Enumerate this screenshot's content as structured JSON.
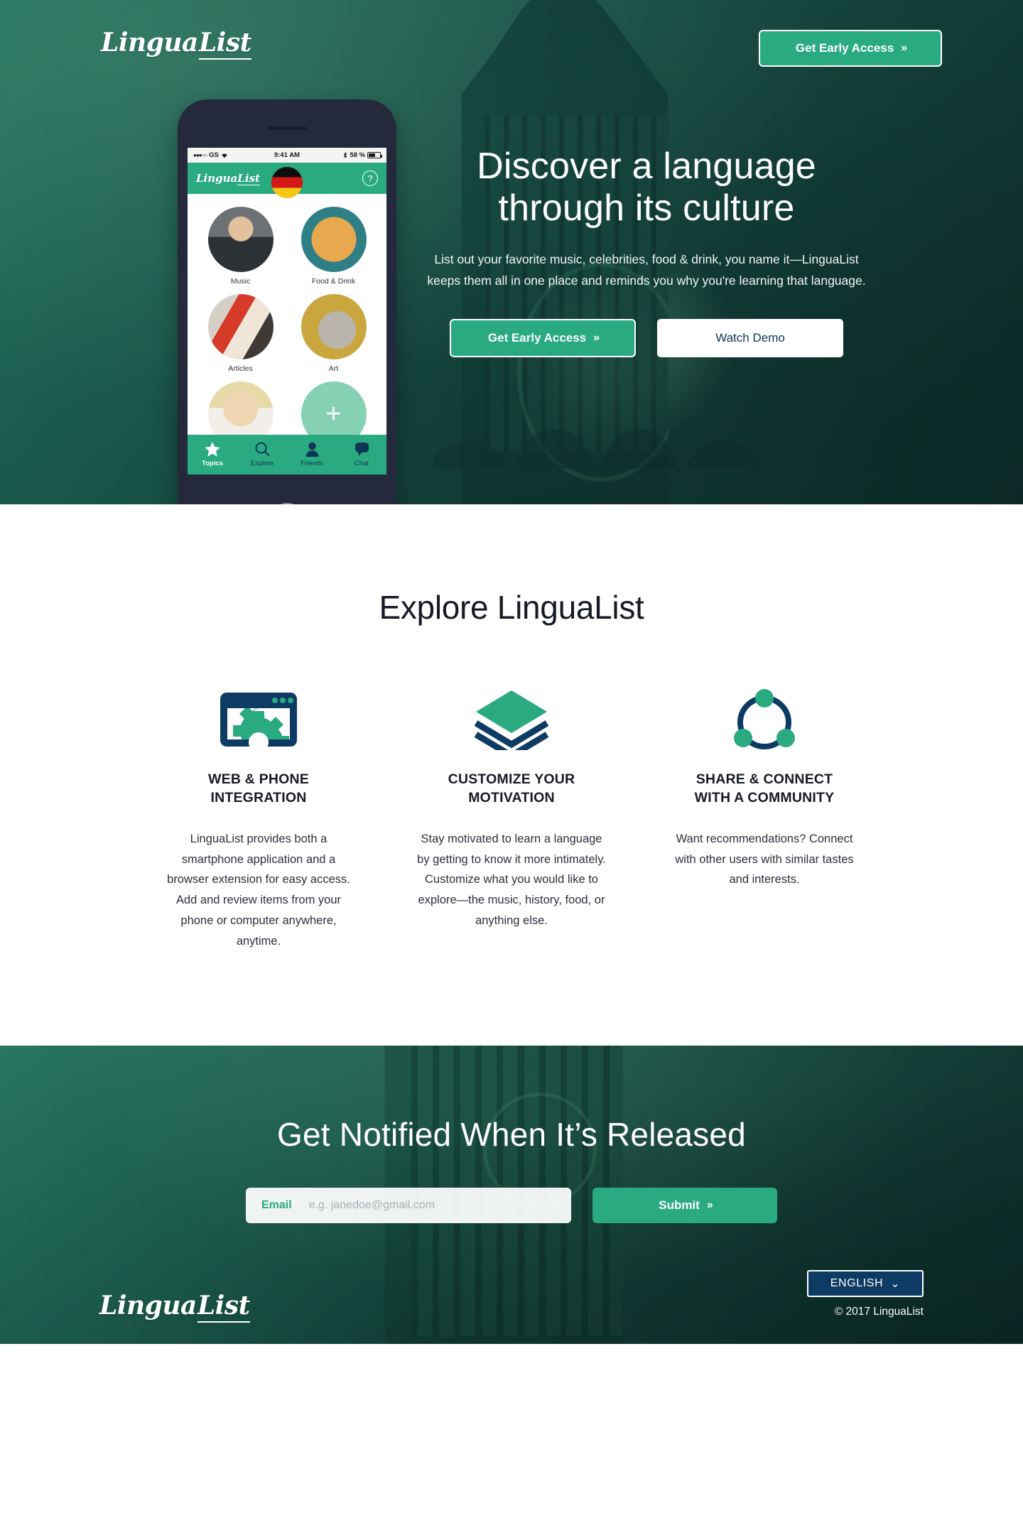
{
  "brand": {
    "name_part1": "Lingua",
    "name_part2": "List",
    "accent_green": "#2aaa80",
    "navy": "#0f3557"
  },
  "header": {
    "logo_part1": "Lingua",
    "logo_part2": "List",
    "cta_label": "Get Early Access",
    "cta_chevron": "»"
  },
  "hero": {
    "title_line1": "Discover a language",
    "title_line2": "through its culture",
    "subtitle": "List out your favorite music, celebrities, food & drink, you name it—LinguaList keeps them all in one place and reminds you why you're learning that language.",
    "primary_cta": "Get Early Access",
    "primary_chevron": "»",
    "secondary_cta": "Watch Demo"
  },
  "phone": {
    "status": {
      "signal_dots": "●●●○○",
      "carrier": "GS",
      "wifi_icon": "wifi-icon",
      "time": "9:41 AM",
      "bluetooth_icon": "bluetooth-icon",
      "battery_percent": "58 %"
    },
    "app_header": {
      "logo_part1": "Lingua",
      "logo_part2": "List",
      "flag": "german-flag",
      "help_label": "?"
    },
    "tiles": [
      {
        "label": "Music",
        "icon": "music-avatar"
      },
      {
        "label": "Food & Drink",
        "icon": "pretzel-photo"
      },
      {
        "label": "Articles",
        "icon": "magazines-photo"
      },
      {
        "label": "Art",
        "icon": "sculpture-photo"
      },
      {
        "label": "",
        "icon": "celebrity-photo"
      },
      {
        "label": "",
        "icon": "add-tile",
        "glyph": "+"
      }
    ],
    "nav": [
      {
        "label": "Topics",
        "icon": "star-icon",
        "active": true
      },
      {
        "label": "Explore",
        "icon": "search-icon",
        "active": false
      },
      {
        "label": "Friends",
        "icon": "person-icon",
        "active": false
      },
      {
        "label": "Chat",
        "icon": "chat-bubble-icon",
        "active": false
      }
    ]
  },
  "features": {
    "heading": "Explore LinguaList",
    "items": [
      {
        "icon": "browser-gear-icon",
        "title_line1": "WEB & PHONE",
        "title_line2": "INTEGRATION",
        "body": "LinguaList provides both a smartphone application and a browser extension for easy access. Add and review items from your phone or computer anywhere, anytime."
      },
      {
        "icon": "layers-icon",
        "title_line1": "CUSTOMIZE YOUR",
        "title_line2": "MOTIVATION",
        "body": "Stay motivated to learn a language by getting to know it more intimately. Customize what you would like to explore—the music, history, food, or anything else."
      },
      {
        "icon": "network-share-icon",
        "title_line1": "SHARE & CONNECT",
        "title_line2": "WITH A COMMUNITY",
        "body": "Want recommendations? Connect with other users with similar tastes and interests."
      }
    ]
  },
  "notify": {
    "heading": "Get Notified When It’s Released",
    "email_label": "Email",
    "email_placeholder": "e.g. janedoe@gmail.com",
    "email_value": "",
    "submit_label": "Submit",
    "submit_chevron": "»"
  },
  "footer": {
    "logo_part1": "Lingua",
    "logo_part2": "List",
    "language_selected": "ENGLISH",
    "language_caret": "⌄",
    "copyright": "© 2017 LinguaList"
  }
}
